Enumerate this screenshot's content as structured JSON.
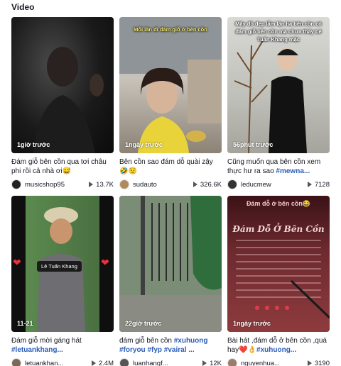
{
  "section_title": "Video",
  "videos": [
    {
      "stamp": "1giờ trước",
      "caption_text": "Đám giỗ bên cồn qua tơi châu phi rồi cả nhà ơi😅",
      "caption_tags": "",
      "author": "musicshop95",
      "plays": "13.7K",
      "avatar_color": "#222222",
      "overlay": ""
    },
    {
      "stamp": "1ngày trước",
      "caption_text": "Bên cồn sao đám dỗ quài zậy 🤣😟",
      "caption_tags": "",
      "author": "sudauto",
      "plays": "326.6K",
      "avatar_color": "#b08a5a",
      "overlay": "Mỗi lần đi đám giỗ ở bên cồn"
    },
    {
      "stamp": "56phút trước",
      "caption_text": "Cũng muốn qua bên cồn xem thực hư ra sao ",
      "caption_tags": "#mewna...",
      "author": "leducmew",
      "plays": "7128",
      "avatar_color": "#333333",
      "overlay": "Mấy đồ đẹp lắm lận hả bên cồn có đám giỗ bên cồn mà chưa thấy Lê Tuấn Khang mặc"
    },
    {
      "stamp": "11-21",
      "caption_text": "Đám giỗ mời gáng hát ",
      "caption_tags": "#letuankhang...",
      "author": "letuankhan...",
      "plays": "2.4M",
      "avatar_color": "#7a6a55",
      "overlay": "Lê Tuấn Khang"
    },
    {
      "stamp": "22giờ trước",
      "caption_text": "đám giỗ bên cồn ",
      "caption_tags": "#xuhuong #foryou #fyp #vairal ...",
      "author": "luanhangf...",
      "plays": "12K",
      "avatar_color": "#555555",
      "overlay": ""
    },
    {
      "stamp": "1ngày trước",
      "caption_text": "Bài hát ,đám dỗ ở bên cồn ,quá hay❤️👌",
      "caption_tags": "#xuhuong...",
      "author": "nguyenhua...",
      "plays": "3190",
      "avatar_color": "#9a7d6a",
      "overlay": "Đám dỗ ở bên cồn😂"
    }
  ],
  "lyrics_title": "Đám Dỗ Ở Bên Cồn",
  "icons": {
    "play": "play-icon",
    "heart": "heart-icon"
  }
}
